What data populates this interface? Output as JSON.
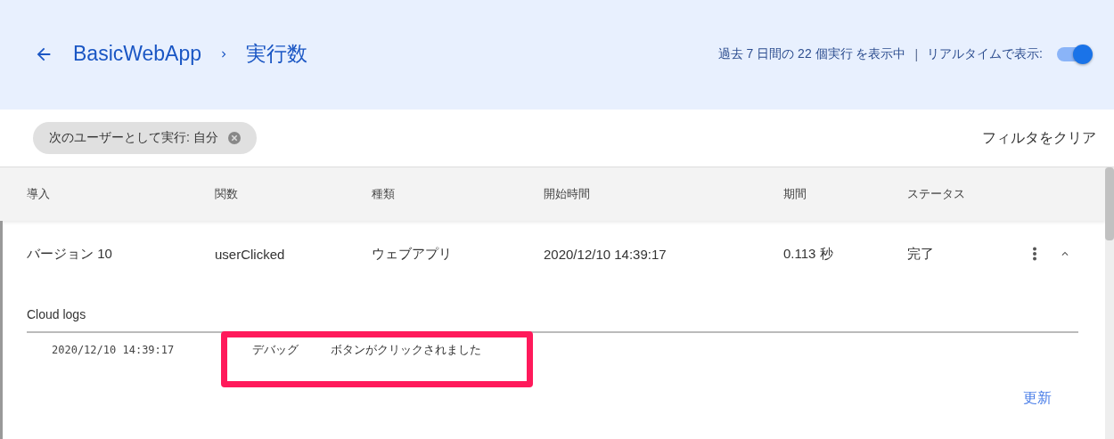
{
  "header": {
    "breadcrumb": [
      "BasicWebApp",
      "実行数"
    ],
    "summary": "過去 7 日間の 22 個実行 を表示中",
    "separator": "|",
    "realtime_label": "リアルタイムで表示:",
    "realtime": {
      "on": true
    }
  },
  "filters": {
    "chips": [
      "次のユーザーとして実行: 自分"
    ],
    "clear": "フィルタをクリア"
  },
  "table": {
    "columns": [
      "導入",
      "関数",
      "種類",
      "開始時間",
      "期間",
      "ステータス"
    ],
    "rows": [
      {
        "cells": [
          "バージョン 10",
          "userClicked",
          "ウェブアプリ",
          "2020/12/10 14:39:17",
          "0.113 秒",
          "完了"
        ],
        "expanded": true,
        "logs": {
          "title": "Cloud logs",
          "entries": [
            {
              "time": "2020/12/10 14:39:17",
              "level": "デバッグ",
              "message": "ボタンがクリックされました",
              "highlighted": true
            }
          ],
          "refresh": "更新"
        }
      }
    ]
  }
}
